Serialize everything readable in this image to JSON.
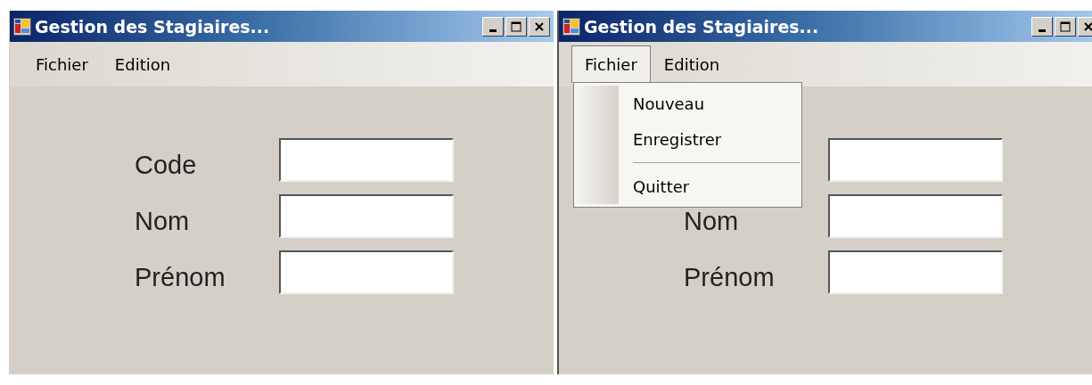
{
  "windows": [
    {
      "title": "Gestion des Stagiaires...",
      "menu": [
        {
          "label": "Fichier",
          "selected": false
        },
        {
          "label": "Edition",
          "selected": false
        }
      ],
      "fields": [
        {
          "kind": "labeled",
          "label": "Code"
        },
        {
          "kind": "labeled",
          "label": "Nom"
        },
        {
          "kind": "labeled",
          "label": "Prénom"
        }
      ]
    },
    {
      "title": "Gestion des Stagiaires...",
      "menu": [
        {
          "label": "Fichier",
          "selected": true,
          "items": [
            {
              "kind": "item",
              "label": "Nouveau"
            },
            {
              "kind": "item",
              "label": "Enregistrer"
            },
            {
              "kind": "separator"
            },
            {
              "kind": "item",
              "label": "Quitter"
            }
          ]
        },
        {
          "label": "Edition",
          "selected": false
        }
      ],
      "fields": [
        {
          "kind": "unlabeled"
        },
        {
          "kind": "labeled",
          "label": "Nom"
        },
        {
          "kind": "labeled",
          "label": "Prénom"
        }
      ]
    }
  ]
}
